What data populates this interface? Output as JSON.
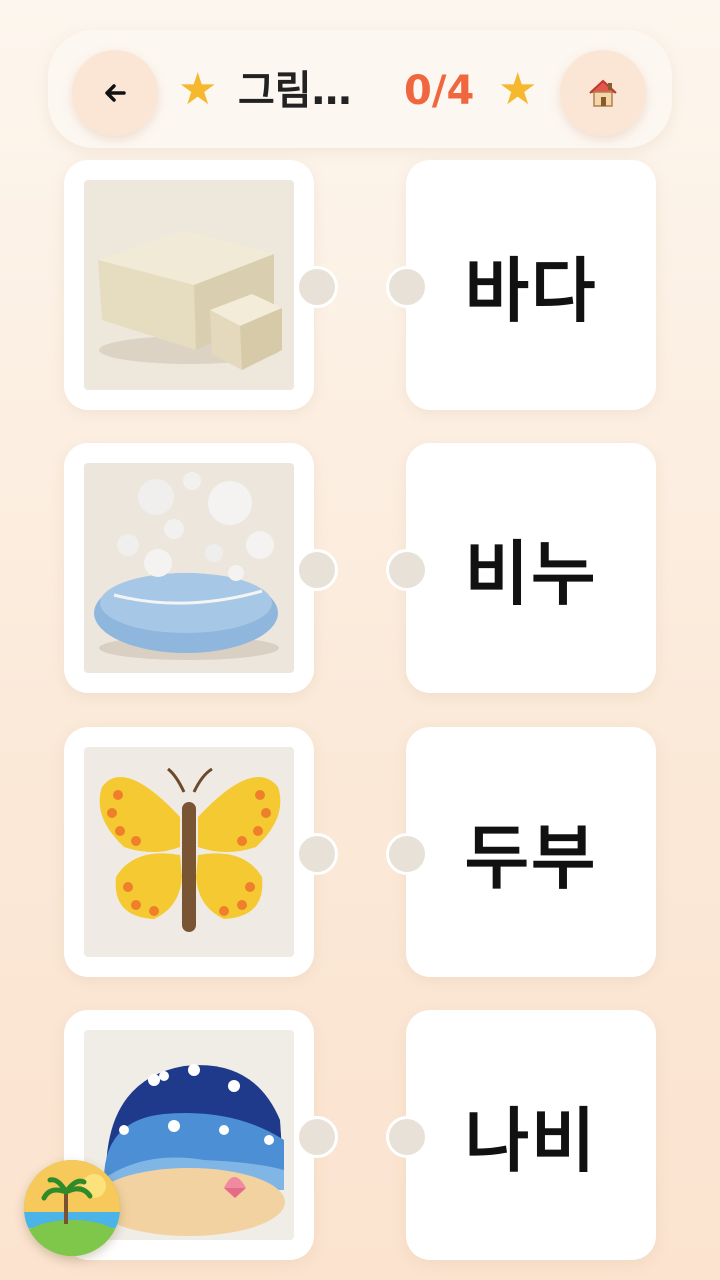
{
  "header": {
    "back_icon": "arrow-left-icon",
    "title": "그림…",
    "score": "0/4",
    "home_icon": "house-icon",
    "star_icon": "star-icon",
    "colors": {
      "score": "#f0663e",
      "star": "#f5b82e"
    }
  },
  "pictures": [
    {
      "id": "tofu",
      "icon": "tofu-image"
    },
    {
      "id": "soap",
      "icon": "soap-image"
    },
    {
      "id": "butterfly",
      "icon": "butterfly-image"
    },
    {
      "id": "sea",
      "icon": "sea-image"
    }
  ],
  "words": [
    {
      "label": "바다"
    },
    {
      "label": "비누"
    },
    {
      "label": "두부"
    },
    {
      "label": "나비"
    }
  ],
  "badge": {
    "icon": "beach-island-icon"
  }
}
